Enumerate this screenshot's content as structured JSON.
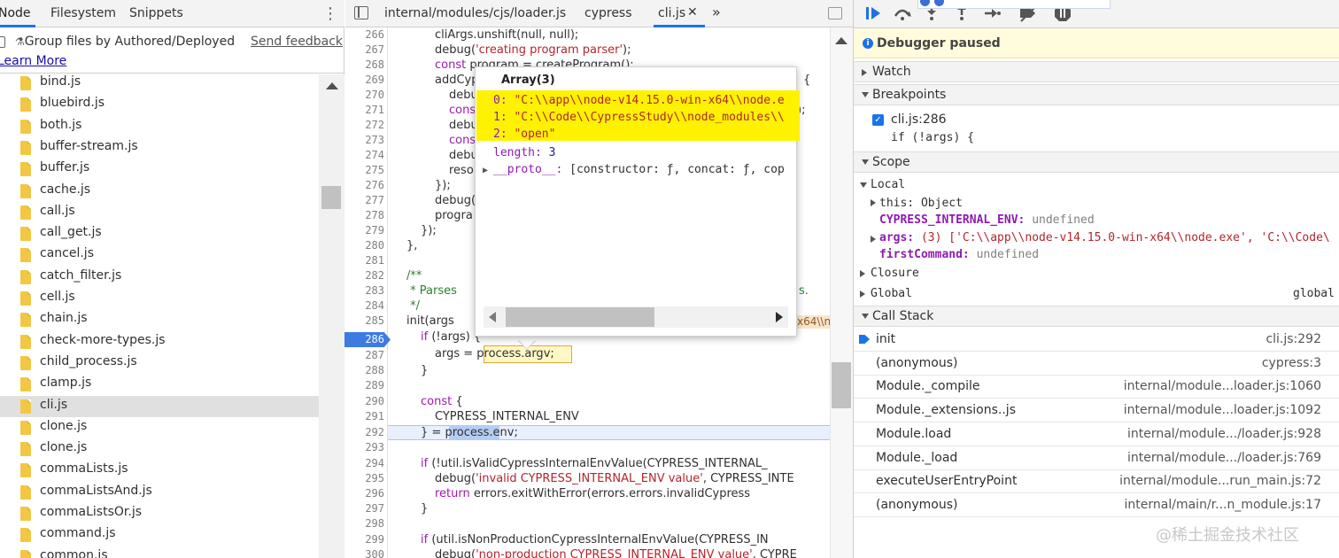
{
  "left_panel": {
    "tabs": [
      "Node",
      "Filesystem",
      "Snippets"
    ],
    "menu_icon": "more-vertical-icon",
    "group_label": "Group files by Authored/Deployed",
    "send_feedback": "Send feedback",
    "learn_more": "Learn More",
    "files": [
      "bind.js",
      "bluebird.js",
      "both.js",
      "buffer-stream.js",
      "buffer.js",
      "cache.js",
      "call.js",
      "call_get.js",
      "cancel.js",
      "catch_filter.js",
      "cell.js",
      "chain.js",
      "check-more-types.js",
      "child_process.js",
      "clamp.js",
      "cli.js",
      "clone.js",
      "clone.js",
      "commaLists.js",
      "commaListsAnd.js",
      "commaListsOr.js",
      "command.js",
      "common.js"
    ],
    "selected_file": "cli.js"
  },
  "editor": {
    "tabs": [
      "internal/modules/cjs/loader.js",
      "cypress",
      "cli.js"
    ],
    "active_tab": "cli.js",
    "close_glyph": "✕",
    "more_glyph": "»",
    "breakpoint_line": "286",
    "current_line": "292",
    "line_numbers": [
      "266",
      "267",
      "268",
      "269",
      "270",
      "271",
      "272",
      "273",
      "274",
      "275",
      "276",
      "277",
      "278",
      "279",
      "280",
      "281",
      "282",
      "283",
      "284",
      "285",
      "286",
      "287",
      "288",
      "289",
      "290",
      "291",
      "292",
      "293",
      "294",
      "295",
      "296",
      "297",
      "298",
      "299",
      "300"
    ],
    "code": {
      "l266": "cliArgs.unshift(null, null);",
      "l267a": "debug(",
      "l267s": "'creating program parser'",
      "l267b": ");",
      "l268k": "const",
      "l268": " program = createProgram();",
      "l269": "addCyp",
      "l269r": "{",
      "l270": "debu",
      "l271": "cons",
      "l271r": ");",
      "l272": "debu",
      "l273": "cons",
      "l274": "debu",
      "l275": "reso",
      "l276": "});",
      "l277": "debug(",
      "l278": "progra",
      "l279": "});",
      "l280": "},",
      "l282": "/**",
      "l283": " * Parses",
      "l283r": "s.",
      "l284": " */",
      "l285": "init(args",
      "l285r": "x64\\\\n",
      "l286k": "if",
      "l286": " (!args) {",
      "l287a": "args = ",
      "l287b": "process.argv",
      "l287c": ";",
      "l288": "}",
      "l290k": "const",
      "l290": " {",
      "l291": "CYPRESS_INTERNAL_ENV",
      "l292a": "} = ",
      "l292b": "process",
      "l292c": ".env;",
      "l294k": "if",
      "l294": " (!util.isValidCypressInternalEnvValue(CYPRESS_INTERNAL_",
      "l295a": "debug(",
      "l295s": "'invalid CYPRESS_INTERNAL_ENV value'",
      "l295b": ", CYPRESS_INTE",
      "l296k": "return",
      "l296": " errors.exitWithError(errors.errors.invalidCypress",
      "l297": "}",
      "l299k": "if",
      "l299": " (util.isNonProductionCypressInternalEnvValue(CYPRESS_IN",
      "l300a": "debug(",
      "l300s": "'non-production CYPRESS_INTERNAL_ENV value'",
      "l300b": ", CYPRE"
    }
  },
  "popover": {
    "title": "Array(3)",
    "items": [
      {
        "key": "0:",
        "value": "\"C:\\\\app\\\\node-v14.15.0-win-x64\\\\node.e"
      },
      {
        "key": "1:",
        "value": "\"C:\\\\Code\\\\CypressStudy\\\\node_modules\\\\"
      },
      {
        "key": "2:",
        "value": "\"open\""
      }
    ],
    "length_key": "length:",
    "length_value": "3",
    "proto_key": "__proto__:",
    "proto_value": " [constructor: ƒ, concat: ƒ, cop"
  },
  "debugger": {
    "toolbar_icons": [
      "resume-icon",
      "step-over-icon",
      "step-into-icon",
      "step-out-icon",
      "step-icon",
      "deactivate-breakpoints-icon",
      "pause-on-exceptions-icon"
    ],
    "paused_label": "Debugger paused",
    "sections": {
      "watch": "Watch",
      "breakpoints": "Breakpoints",
      "scope": "Scope",
      "call_stack": "Call Stack"
    },
    "breakpoint": {
      "file": "cli.js:286",
      "code": "if (!args) {"
    },
    "scope": {
      "local": "Local",
      "this_key": "this:",
      "this_value": " Object",
      "env_key": "CYPRESS_INTERNAL_ENV:",
      "env_value": " undefined",
      "args_key": "args:",
      "args_value": " (3) ['C:\\\\app\\\\node-v14.15.0-win-x64\\\\node.exe', 'C:\\\\Code\\",
      "first_key": "firstCommand:",
      "first_value": " undefined",
      "closure": "Closure",
      "global": "Global",
      "global_value": "global"
    },
    "call_stack": [
      {
        "fn": "init",
        "loc": "cli.js:292"
      },
      {
        "fn": "(anonymous)",
        "loc": "cypress:3"
      },
      {
        "fn": "Module._compile",
        "loc": "internal/module...loader.js:1060"
      },
      {
        "fn": "Module._extensions..js",
        "loc": "internal/module...loader.js:1092"
      },
      {
        "fn": "Module.load",
        "loc": "internal/module.../loader.js:928"
      },
      {
        "fn": "Module._load",
        "loc": "internal/module.../loader.js:769"
      },
      {
        "fn": "executeUserEntryPoint",
        "loc": "internal/module...run_main.js:72"
      },
      {
        "fn": "(anonymous)",
        "loc": "internal/main/r...n_module.js:17"
      }
    ]
  },
  "watermark": "@稀土掘金技术社区",
  "colors": {
    "accent": "#1a73e8",
    "paused_bg": "#fffbdc",
    "popover_highlight": "#fff200",
    "keyword": "#9c1bab",
    "string": "#b2262c",
    "comment": "#2e7d32"
  }
}
